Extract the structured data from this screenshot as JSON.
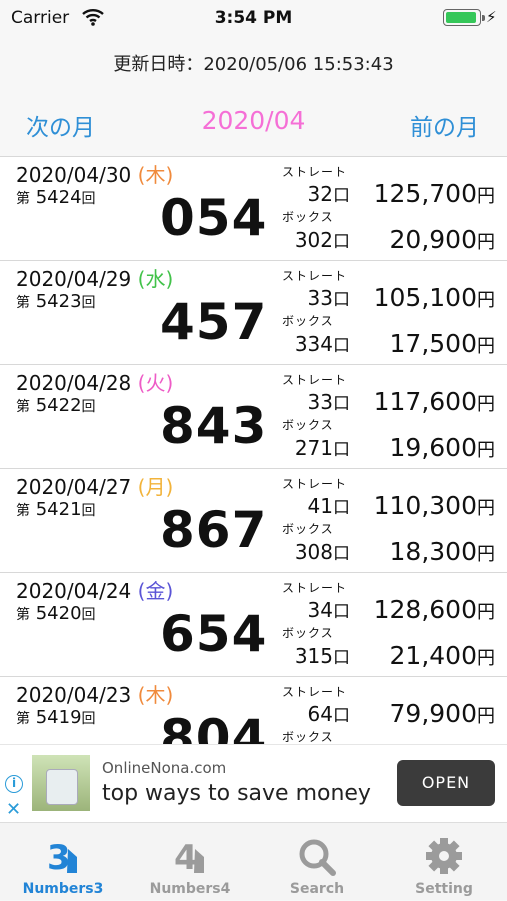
{
  "status_bar": {
    "carrier": "Carrier",
    "time": "3:54 PM",
    "battery_level": 1.0
  },
  "updated": "更新日時：2020/05/06 15:53:43",
  "nav": {
    "prev_label": "次の月",
    "month": "2020/04",
    "next_label": "前の月"
  },
  "labels": {
    "straight": "ストレート",
    "box": "ボックス",
    "kai_prefix": "第",
    "kai_suffix": "回",
    "kuchi": "口",
    "yen": "円"
  },
  "results": [
    {
      "date": "2020/04/30",
      "weekday": "(木)",
      "weekday_color": "#f08a3c",
      "draw": "5424",
      "number": "054",
      "straight_count": "32",
      "box_count": "302",
      "straight_prize": "125,700",
      "box_prize": "20,900"
    },
    {
      "date": "2020/04/29",
      "weekday": "(水)",
      "weekday_color": "#42c24a",
      "draw": "5423",
      "number": "457",
      "straight_count": "33",
      "box_count": "334",
      "straight_prize": "105,100",
      "box_prize": "17,500"
    },
    {
      "date": "2020/04/28",
      "weekday": "(火)",
      "weekday_color": "#ee5bc6",
      "draw": "5422",
      "number": "843",
      "straight_count": "33",
      "box_count": "271",
      "straight_prize": "117,600",
      "box_prize": "19,600"
    },
    {
      "date": "2020/04/27",
      "weekday": "(月)",
      "weekday_color": "#f2b33a",
      "draw": "5421",
      "number": "867",
      "straight_count": "41",
      "box_count": "308",
      "straight_prize": "110,300",
      "box_prize": "18,300"
    },
    {
      "date": "2020/04/24",
      "weekday": "(金)",
      "weekday_color": "#5a54d6",
      "draw": "5420",
      "number": "654",
      "straight_count": "34",
      "box_count": "315",
      "straight_prize": "128,600",
      "box_prize": "21,400"
    },
    {
      "date": "2020/04/23",
      "weekday": "(木)",
      "weekday_color": "#f08a3c",
      "draw": "5419",
      "number": "804",
      "straight_count": "64",
      "box_count": "",
      "straight_prize": "79,900",
      "box_prize": ""
    }
  ],
  "ad": {
    "domain": "OnlineNona.com",
    "headline": "top ways to save money",
    "button": "OPEN",
    "info_icon": "info-icon",
    "close_icon": "close-icon"
  },
  "tabs": [
    {
      "label": "Numbers3",
      "icon": "numbers3-icon",
      "active": true
    },
    {
      "label": "Numbers4",
      "icon": "numbers4-icon",
      "active": false
    },
    {
      "label": "Search",
      "icon": "search-icon",
      "active": false
    },
    {
      "label": "Setting",
      "icon": "gear-icon",
      "active": false
    }
  ],
  "colors": {
    "accent": "#2f8fd6",
    "month": "#f56fd6",
    "tab_active": "#2284d6",
    "tab_inactive": "#9b9b9b"
  }
}
